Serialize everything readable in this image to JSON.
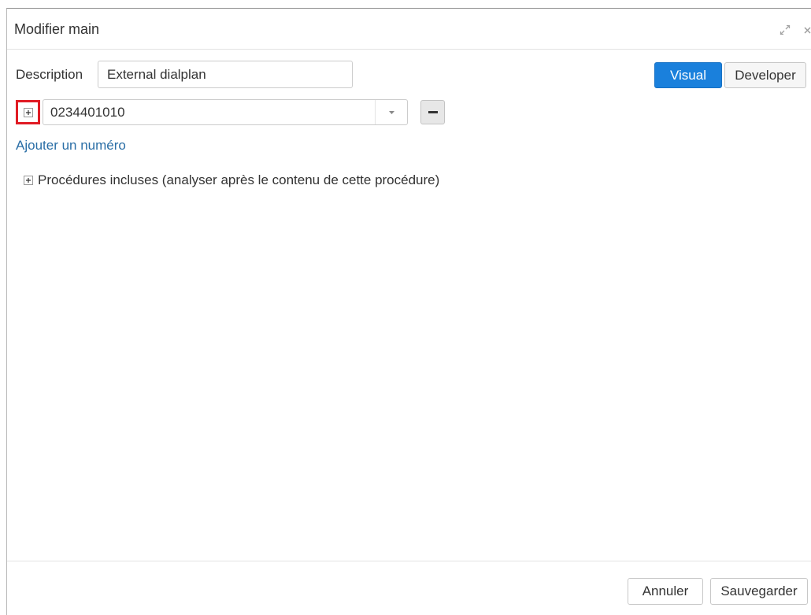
{
  "colors": {
    "accent": "#1a80dc",
    "link": "#2a6ea6",
    "highlight": "#e01b24",
    "text": "#333333"
  },
  "icons": {
    "maximize": "expand-arrows-icon",
    "close": "close-icon",
    "expand_number": "plus-box-icon",
    "dropdown": "caret-down-icon",
    "remove_number": "minus-icon",
    "expand_procedures": "plus-box-icon"
  },
  "dialog": {
    "title": "Modifier main"
  },
  "form": {
    "description": {
      "label": "Description",
      "value": "External dialplan"
    },
    "mode_toggle": {
      "options": [
        "Visual",
        "Developer"
      ],
      "selected_index": 0
    },
    "numbers": [
      {
        "value": "0234401010"
      }
    ],
    "add_number_link": "Ajouter un numéro",
    "included_procedures_label": "Procédures incluses (analyser après le contenu de cette procédure)"
  },
  "footer": {
    "cancel_label": "Annuler",
    "save_label": "Sauvegarder"
  }
}
